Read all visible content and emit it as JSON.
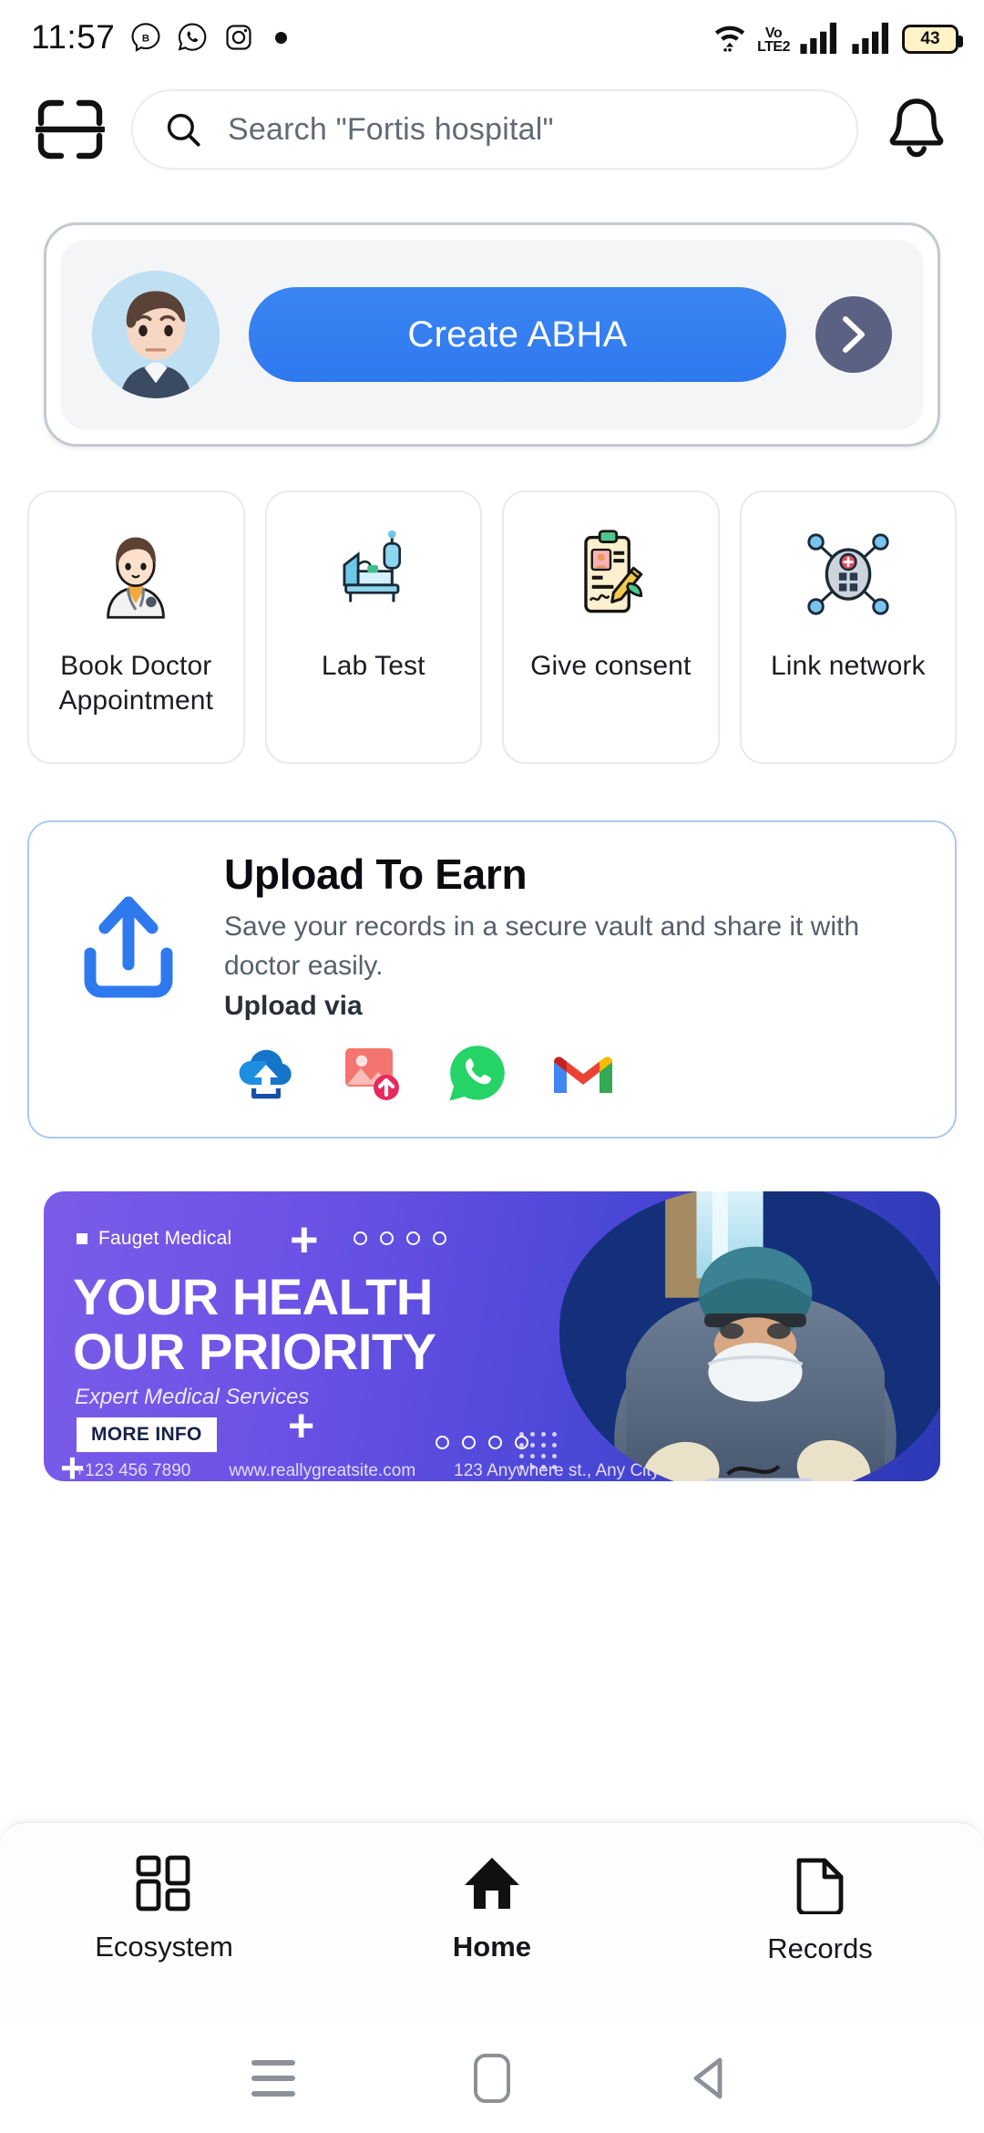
{
  "status_bar": {
    "time": "11:57",
    "app_icons": [
      "bluesky-icon",
      "whatsapp-icon",
      "instagram-icon"
    ],
    "dot_indicator": "•",
    "wifi": "wifi-icon",
    "network_label_top": "Vo",
    "network_label_bottom": "LTE2",
    "signal_bars": 2,
    "battery_percent": "43"
  },
  "header": {
    "scan_icon": "scanner-icon",
    "search_placeholder": "Search \"Fortis hospital\"",
    "search_value": "",
    "search_icon": "search-icon",
    "notification_icon": "bell-icon"
  },
  "abha_card": {
    "avatar": "user-avatar",
    "button_label": "Create ABHA",
    "arrow_icon": "chevron-right-icon",
    "button_color": "#2f79ef",
    "arrow_bg_color": "#5b6183"
  },
  "quick_actions": [
    {
      "label": "Book Doctor Appointment",
      "icon": "doctor-icon"
    },
    {
      "label": "Lab Test",
      "icon": "hospital-bed-iv-icon"
    },
    {
      "label": "Give consent",
      "icon": "consent-form-icon"
    },
    {
      "label": "Link network",
      "icon": "network-link-icon"
    }
  ],
  "upload_card": {
    "icon": "upload-arrow-icon",
    "title": "Upload To Earn",
    "subtitle": "Save your records in a secure vault and share it with doctor easily.",
    "upload_via_label": "Upload via",
    "accent_color": "#2f79ef",
    "sources": [
      {
        "name": "cloud-upload-icon",
        "color": "#1d7ae0"
      },
      {
        "name": "gallery-upload-icon",
        "color": "#f06b78"
      },
      {
        "name": "whatsapp-icon",
        "color": "#25d366"
      },
      {
        "name": "gmail-icon",
        "color": "#ea4335"
      }
    ]
  },
  "banner": {
    "brand": "Fauget Medical",
    "headline_line1": "YOUR HEALTH",
    "headline_line2": "OUR PRIORITY",
    "tagline": "Expert Medical Services",
    "cta_label": "MORE INFO",
    "phone": "+123 456 7890",
    "website": "www.reallygreatsite.com",
    "address": "123 Anywhere st., Any City",
    "gradient_from": "#7b5ce8",
    "gradient_to": "#2c39b5",
    "photo": "surgeon-operating-photo"
  },
  "bottom_nav": {
    "active": "Home",
    "items": [
      {
        "label": "Ecosystem",
        "icon": "grid-icon",
        "active": false
      },
      {
        "label": "Home",
        "icon": "home-icon",
        "active": true
      },
      {
        "label": "Records",
        "icon": "document-icon",
        "active": false
      }
    ]
  },
  "android_nav": {
    "recents": "recents-icon",
    "home": "home-pill-icon",
    "back": "back-triangle-icon"
  }
}
